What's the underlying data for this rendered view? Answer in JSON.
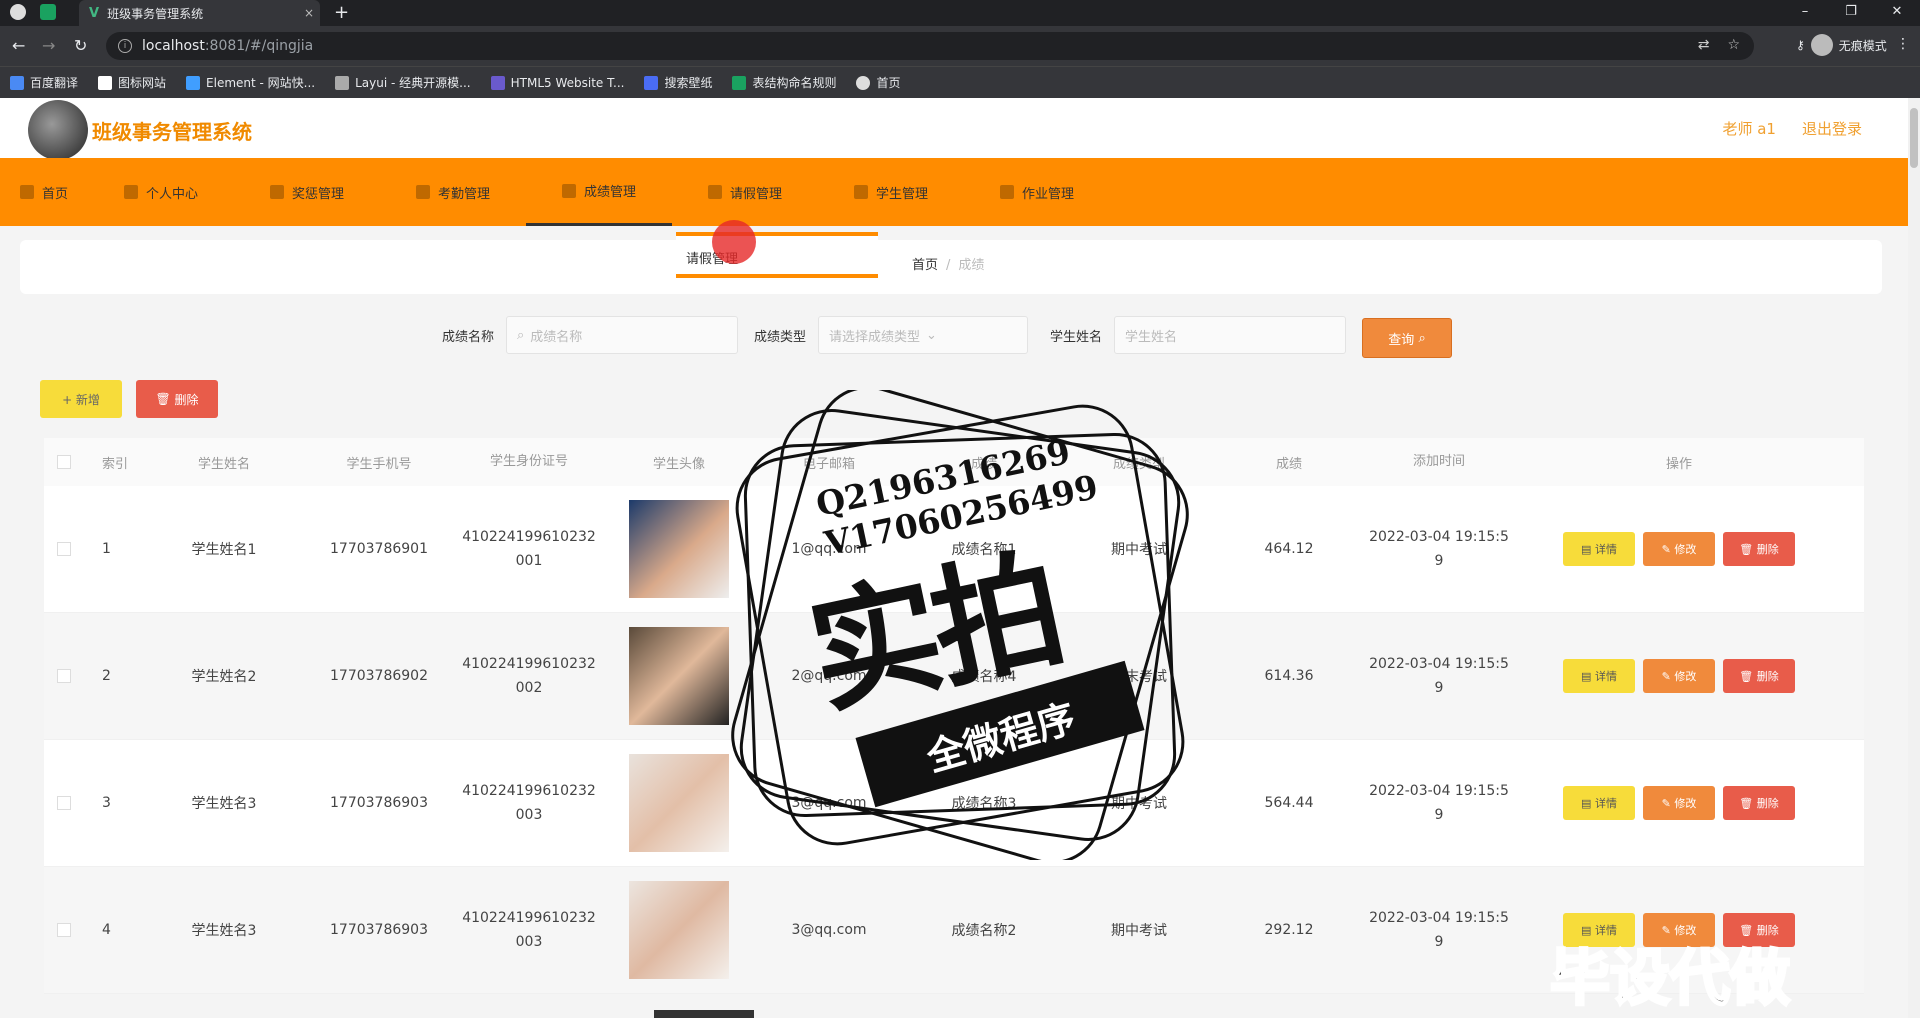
{
  "browser": {
    "tab_title": "班级事务管理系统",
    "tab_close": "×",
    "new_tab": "+",
    "url_host": "localhost",
    "url_path": ":8081/#/qingjia",
    "profile_label": "无痕模式",
    "bookmarks": [
      "百度翻译",
      "图标网站",
      "Element - 网站快...",
      "Layui - 经典开源模...",
      "HTML5 Website T...",
      "搜索壁纸",
      "表结构命名规则",
      "首页"
    ]
  },
  "header": {
    "title": "班级事务管理系统",
    "user_label": "老师 a1",
    "logout_label": "退出登录"
  },
  "menu": {
    "items": [
      "首页",
      "个人中心",
      "奖惩管理",
      "考勤管理",
      "成绩管理",
      "请假管理",
      "学生管理",
      "作业管理"
    ],
    "active_index": 4
  },
  "dropdown": {
    "label": "请假管理"
  },
  "breadcrumb": {
    "home": "首页",
    "sep": "/",
    "current": "成绩"
  },
  "search": {
    "grade_name_label": "成绩名称",
    "grade_name_placeholder": "成绩名称",
    "grade_type_label": "成绩类型",
    "grade_type_placeholder": "请选择成绩类型",
    "student_name_label": "学生姓名",
    "student_name_placeholder": "学生姓名",
    "query_label": "查询"
  },
  "actions": {
    "add_label": "+ 新增",
    "delete_label": "删除"
  },
  "table": {
    "headers": [
      "索引",
      "学生姓名",
      "学生手机号",
      "学生身份证号",
      "学生头像",
      "电子邮箱",
      "成绩",
      "成绩类型",
      "成绩",
      "添加时间",
      "操作"
    ],
    "rows": [
      {
        "idx": "1",
        "name": "学生姓名1",
        "phone": "17703786901",
        "id_a": "410224199610232",
        "id_b": "001",
        "email": "1@qq.com",
        "gname": "成绩名称1",
        "gtype": "期中考试",
        "score": "464.12",
        "time_a": "2022-03-04 19:15:5",
        "time_b": "9"
      },
      {
        "idx": "2",
        "name": "学生姓名2",
        "phone": "17703786902",
        "id_a": "410224199610232",
        "id_b": "002",
        "email": "2@qq.com",
        "gname": "成绩名称4",
        "gtype": "期末考试",
        "score": "614.36",
        "time_a": "2022-03-04 19:15:5",
        "time_b": "9"
      },
      {
        "idx": "3",
        "name": "学生姓名3",
        "phone": "17703786903",
        "id_a": "410224199610232",
        "id_b": "003",
        "email": "3@qq.com",
        "gname": "成绩名称3",
        "gtype": "期中考试",
        "score": "564.44",
        "time_a": "2022-03-04 19:15:5",
        "time_b": "9"
      },
      {
        "idx": "4",
        "name": "学生姓名3",
        "phone": "17703786903",
        "id_a": "410224199610232",
        "id_b": "003",
        "email": "3@qq.com",
        "gname": "成绩名称2",
        "gtype": "期中考试",
        "score": "292.12",
        "time_a": "2022-03-04 19:15:5",
        "time_b": "9"
      }
    ],
    "op_detail": "详情",
    "op_edit": "修改",
    "op_delete": "删除"
  },
  "watermark": {
    "qq": "Q2196316269",
    "vx": "V17060256499",
    "big": "实拍",
    "banner": "全微程序",
    "corner": "毕设代做"
  }
}
